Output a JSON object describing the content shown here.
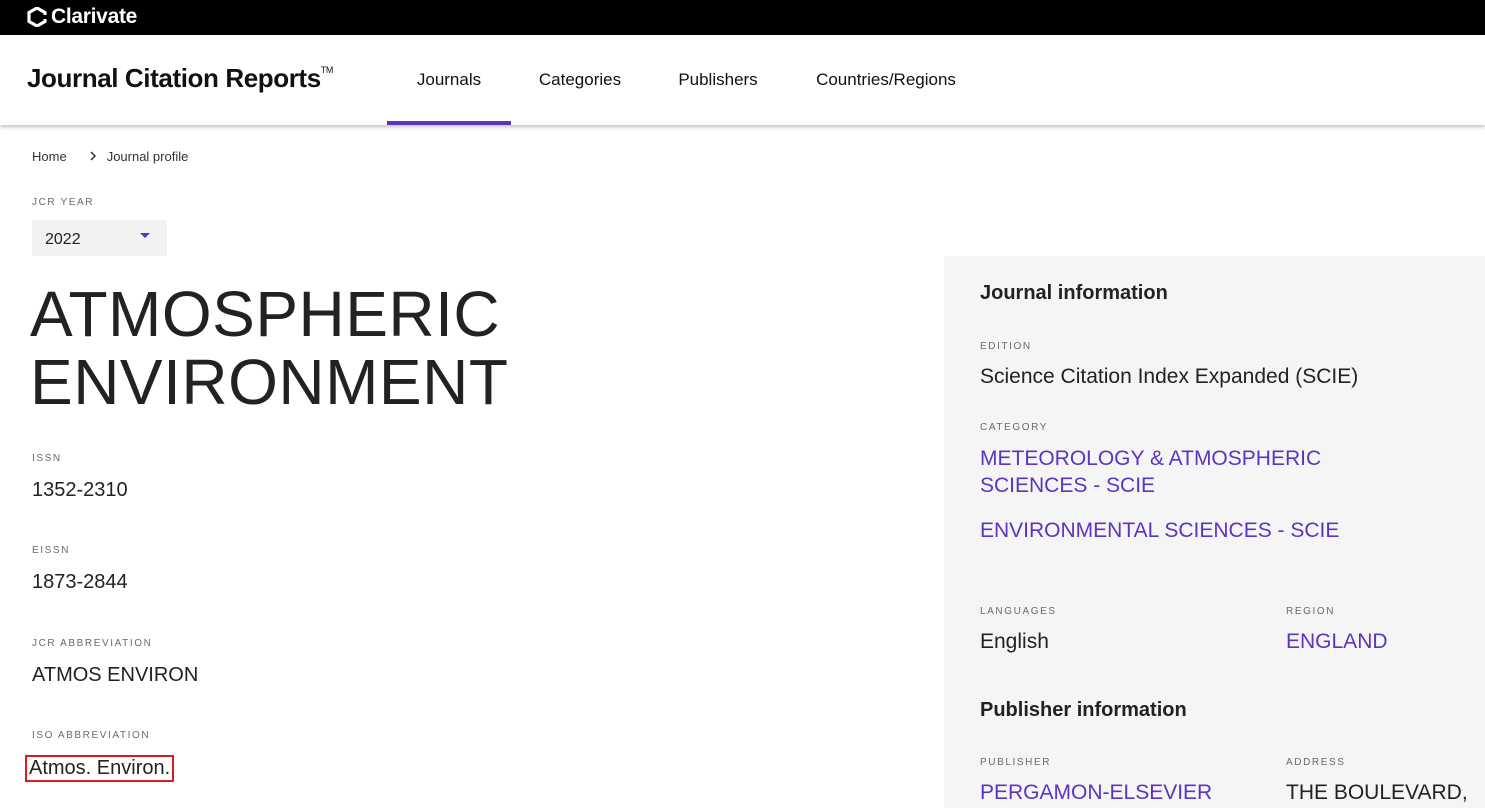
{
  "brand": {
    "name": "Clarivate"
  },
  "header": {
    "app_title": "Journal Citation Reports",
    "trademark": "TM"
  },
  "nav": {
    "items": [
      {
        "label": "Journals",
        "active": true
      },
      {
        "label": "Categories",
        "active": false
      },
      {
        "label": "Publishers",
        "active": false
      },
      {
        "label": "Countries/Regions",
        "active": false
      }
    ]
  },
  "breadcrumb": {
    "home": "Home",
    "current": "Journal profile"
  },
  "jcr_year": {
    "label": "JCR YEAR",
    "value": "2022"
  },
  "journal": {
    "title_line1": "ATMOSPHERIC",
    "title_line2": "ENVIRONMENT",
    "issn_label": "ISSN",
    "issn": "1352-2310",
    "eissn_label": "EISSN",
    "eissn": "1873-2844",
    "jcr_abbrev_label": "JCR ABBREVIATION",
    "jcr_abbrev": "ATMOS ENVIRON",
    "iso_abbrev_label": "ISO ABBREVIATION",
    "iso_abbrev": "Atmos. Environ."
  },
  "panel": {
    "journal_info_heading": "Journal information",
    "edition_label": "EDITION",
    "edition": "Science Citation Index Expanded (SCIE)",
    "category_label": "CATEGORY",
    "category_1_line1": "METEOROLOGY & ATMOSPHERIC",
    "category_1_line2": "SCIENCES - SCIE",
    "category_2": "ENVIRONMENTAL SCIENCES - SCIE",
    "languages_label": "LANGUAGES",
    "languages": "English",
    "region_label": "REGION",
    "region": "ENGLAND",
    "publisher_info_heading": "Publisher information",
    "publisher_label": "PUBLISHER",
    "publisher": "PERGAMON-ELSEVIER",
    "address_label": "ADDRESS",
    "address": "THE BOULEVARD,"
  },
  "colors": {
    "accent": "#5e33bf",
    "highlight_box": "#e11b1b",
    "topbar": "#000000",
    "panel_bg": "#f5f5f5"
  },
  "icons": {
    "brand": "clarivate-logo-icon",
    "breadcrumb_sep": "chevron-right-icon",
    "dropdown": "caret-down-icon"
  }
}
